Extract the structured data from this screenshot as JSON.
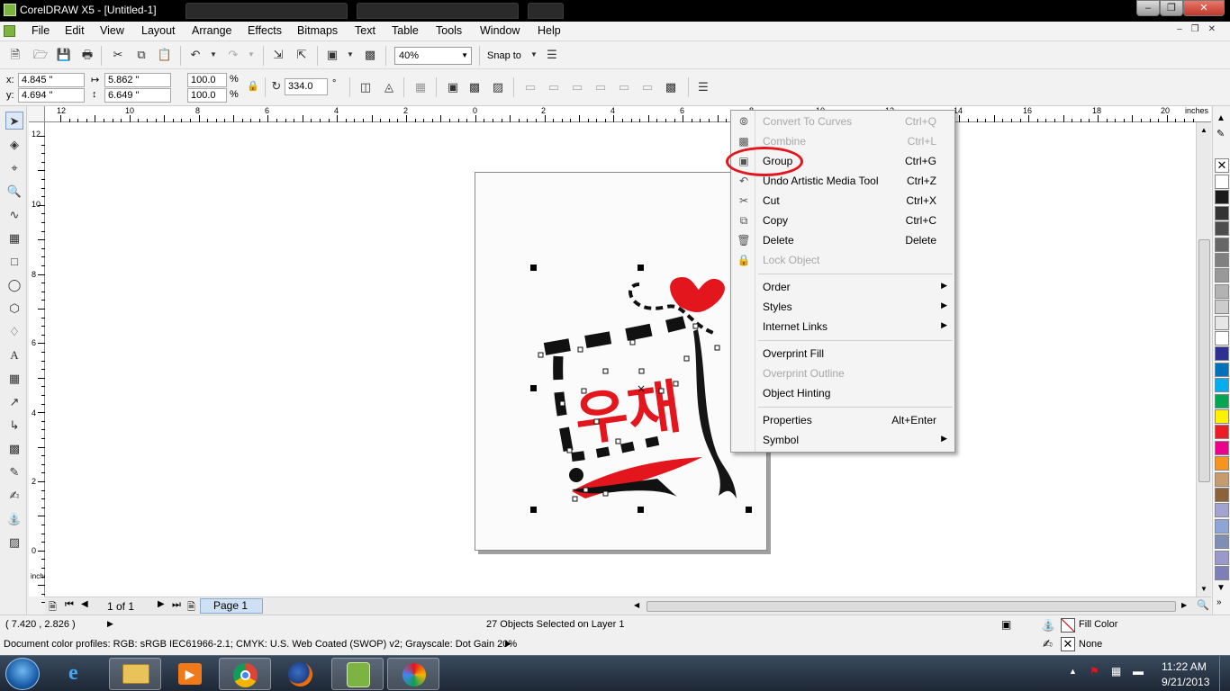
{
  "window": {
    "title": "CorelDRAW X5 - [Untitled-1]"
  },
  "menubar": {
    "items": [
      "File",
      "Edit",
      "View",
      "Layout",
      "Arrange",
      "Effects",
      "Bitmaps",
      "Text",
      "Table",
      "Tools",
      "Window",
      "Help"
    ]
  },
  "standard_toolbar": {
    "zoom": "40%",
    "snap_to": "Snap to"
  },
  "property_bar": {
    "x": "4.845 \"",
    "y": "4.694 \"",
    "width": "5.862 \"",
    "height": "6.649 \"",
    "scale_x": "100.0",
    "scale_y": "100.0",
    "percent": "%",
    "rotation": "334.0",
    "degree": "°"
  },
  "rulers": {
    "unit": "inches",
    "h_labels": [
      "12",
      "10",
      "8",
      "6",
      "4",
      "2",
      "0",
      "2",
      "4",
      "6",
      "8",
      "10",
      "12",
      "14",
      "16",
      "18",
      "20"
    ],
    "v_labels": [
      "12",
      "10",
      "8",
      "6",
      "4",
      "2",
      "0"
    ]
  },
  "context_menu": {
    "groups": [
      [
        {
          "label": "Convert To Curves",
          "shortcut": "Ctrl+Q",
          "disabled": true,
          "icon": "convert-curves-icon"
        },
        {
          "label": "Combine",
          "shortcut": "Ctrl+L",
          "disabled": true,
          "icon": "combine-icon"
        },
        {
          "label": "Group",
          "shortcut": "Ctrl+G",
          "disabled": false,
          "icon": "group-icon"
        },
        {
          "label": "Undo Artistic Media Tool",
          "shortcut": "Ctrl+Z",
          "disabled": false,
          "icon": "undo-icon"
        },
        {
          "label": "Cut",
          "shortcut": "Ctrl+X",
          "disabled": false,
          "icon": "scissors-icon"
        },
        {
          "label": "Copy",
          "shortcut": "Ctrl+C",
          "disabled": false,
          "icon": "copy-icon"
        },
        {
          "label": "Delete",
          "shortcut": "Delete",
          "disabled": false,
          "icon": "trash-icon"
        },
        {
          "label": "Lock Object",
          "shortcut": "",
          "disabled": true,
          "icon": "lock-icon"
        }
      ],
      [
        {
          "label": "Order",
          "submenu": true
        },
        {
          "label": "Styles",
          "submenu": true
        },
        {
          "label": "Internet Links",
          "submenu": true
        }
      ],
      [
        {
          "label": "Overprint Fill",
          "disabled": false
        },
        {
          "label": "Overprint Outline",
          "disabled": true
        },
        {
          "label": "Object Hinting",
          "disabled": false
        }
      ],
      [
        {
          "label": "Properties",
          "shortcut": "Alt+Enter"
        },
        {
          "label": "Symbol",
          "submenu": true
        }
      ]
    ]
  },
  "page_nav": {
    "counter": "1 of 1",
    "page_tab": "Page 1"
  },
  "status": {
    "cursor": "( 7.420 , 2.826 )",
    "selection": "27 Objects Selected on Layer 1",
    "fill": "Fill Color",
    "outline": "None",
    "profiles": "Document color profiles: RGB: sRGB IEC61966-2.1; CMYK: U.S. Web Coated (SWOP) v2; Grayscale: Dot Gain 20%"
  },
  "palette": {
    "colors": [
      "#ffffff",
      "#1a1a1a",
      "#333333",
      "#4d4d4d",
      "#666666",
      "#808080",
      "#999999",
      "#b3b3b3",
      "#cccccc",
      "#e6e6e6",
      "#ffffff",
      "#2e3192",
      "#0072bc",
      "#00aeef",
      "#00a651",
      "#fff200",
      "#ed1c24",
      "#ec008c",
      "#f7941d",
      "#c69c6d",
      "#8c6239",
      "#a3a3d1",
      "#8fa5d8",
      "#7f8fb3",
      "#9999cc",
      "#7e7eb8"
    ]
  },
  "taskbar": {
    "time": "11:22 AM",
    "date": "9/21/2013"
  },
  "accent": {
    "highlight": "#e3161d",
    "selection_tab": "#cfe0f4"
  }
}
